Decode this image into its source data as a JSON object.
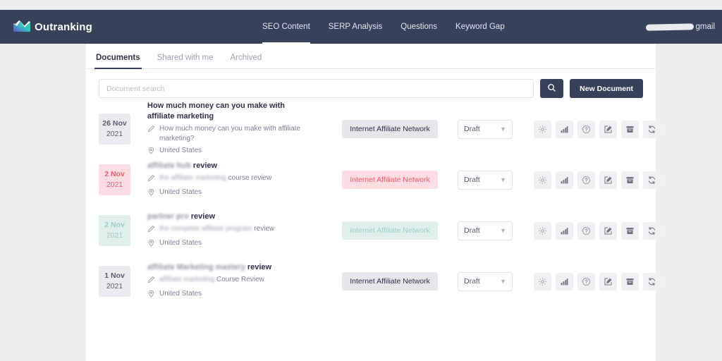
{
  "colors": {
    "nav_bg": "#37415a",
    "page_bg": "#eceef0",
    "card_bg": "#ffffff",
    "accent_dark": "#37415a",
    "chip_gray_bg": "#e4e6e9",
    "chip_gray_text": "#2c3347",
    "chip_pink_bg": "#fbdde2",
    "chip_pink_text": "#ef5a74",
    "chip_mint_bg": "#e0efec",
    "chip_mint_text": "#8fc7bd"
  },
  "topnav": {
    "brand": "Outranking",
    "brand_icon": "mountain-arrow-logo",
    "links": [
      {
        "label": "SEO Content",
        "active": true
      },
      {
        "label": "SERP Analysis",
        "active": false
      },
      {
        "label": "Questions",
        "active": false
      },
      {
        "label": "Keyword Gap",
        "active": false
      }
    ],
    "account": {
      "redacted": true,
      "label": "gmail"
    }
  },
  "tabs": [
    {
      "label": "Documents",
      "active": true
    },
    {
      "label": "Shared with me",
      "active": false
    },
    {
      "label": "Archived",
      "active": false
    }
  ],
  "search": {
    "placeholder": "Document search",
    "value": "",
    "search_icon": "search-icon",
    "new_document_label": "New Document"
  },
  "actions_icons": [
    "gear-icon",
    "bar-chart-icon",
    "question-circle-icon",
    "edit-square-icon",
    "archive-box-icon",
    "refresh-icon"
  ],
  "documents": [
    {
      "date_day": "26",
      "date_month": "Nov",
      "date_year": "2021",
      "date_style": "gray",
      "title": "How much money can you make with affiliate marketing",
      "title_blurred": false,
      "subtitle": "How much money can you make with affiliate marketing?",
      "subtitle_blurred": false,
      "location": "United States",
      "chip_label": "Internet Affiliate Network",
      "chip_style": "gray",
      "status": "Draft"
    },
    {
      "date_day": "2",
      "date_month": "Nov",
      "date_year": "2021",
      "date_style": "pink",
      "title_blur_prefix": "affiliate hub",
      "title_suffix": "review",
      "title_blurred": true,
      "subtitle_blur_prefix": "the affiliate marketing",
      "subtitle_suffix": "course review",
      "subtitle_blurred": true,
      "location": "United States",
      "chip_label": "Internet Affiliate Network",
      "chip_style": "pink",
      "status": "Draft"
    },
    {
      "date_day": "2",
      "date_month": "Nov",
      "date_year": "2021",
      "date_style": "mint",
      "title_blur_prefix": "partner pro",
      "title_suffix": "review",
      "title_blurred": true,
      "subtitle_blur_prefix": "the complete affiliate program",
      "subtitle_suffix": "review",
      "subtitle_blurred": true,
      "location": "United States",
      "chip_label": "Internet Affiliate Network",
      "chip_style": "mint",
      "status": "Draft"
    },
    {
      "date_day": "1",
      "date_month": "Nov",
      "date_year": "2021",
      "date_style": "gray",
      "title_blur_prefix": "affiliate Marketing mastery",
      "title_suffix": "review",
      "title_blurred": true,
      "subtitle_blur_prefix": "affiliate  marketing",
      "subtitle_suffix": "Course Review",
      "subtitle_blurred": true,
      "location": "United States",
      "chip_label": "Internet Affiliate Network",
      "chip_style": "gray",
      "status": "Draft"
    }
  ]
}
